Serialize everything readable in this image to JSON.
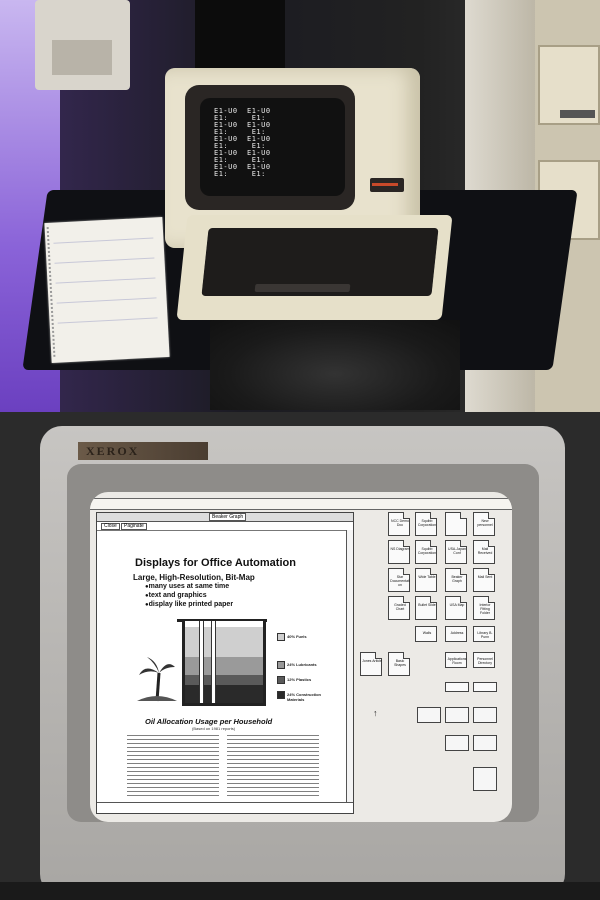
{
  "top_photo": {
    "terminal_screen_text": "E1-U0  E1-U0\nE1:     E1:\nE1-U0  E1-U0\nE1:     E1:\nE1-U0  E1-U0\nE1:     E1:\nE1-U0  E1-U0\nE1:     E1:\nE1-U0  E1-U0\nE1:     E1:"
  },
  "bottom_photo": {
    "brand": "XEROX",
    "document": {
      "window_title": "Beaker Graph",
      "commands": [
        "Close",
        "Paginate"
      ],
      "heading": "Displays for Office Automation",
      "subheading": "Large, High-Resolution, Bit-Map",
      "bullets": [
        "many uses at same time",
        "text and graphics",
        "display like printed paper"
      ],
      "legend": [
        "40% Fuels",
        "24% Lubricants",
        "12% Plastics",
        "24% Construction Materials"
      ],
      "caption": "Oil Allocation Usage per Household",
      "caption_note": "(Based on 1981 reports)"
    },
    "desktop_icons": [
      "NCC Demo Doc",
      "Squibb Corporation",
      "",
      "New personnel",
      "NS Diagram",
      "Squibb Corporation",
      "USA-Japan Conf",
      "Mail Received",
      "Star Documentation",
      "Wide Table",
      "Beaker Graph",
      "Mail Sent",
      "Graded Chart",
      "Bullet Slide",
      "USA Map",
      "Interior Fitting Folder"
    ],
    "lower_icons": [
      "Walls",
      "Address",
      "Library B-Punn",
      "Applications Room",
      "Personnel Directory",
      "Jones Article",
      "Basic Shapes"
    ]
  }
}
